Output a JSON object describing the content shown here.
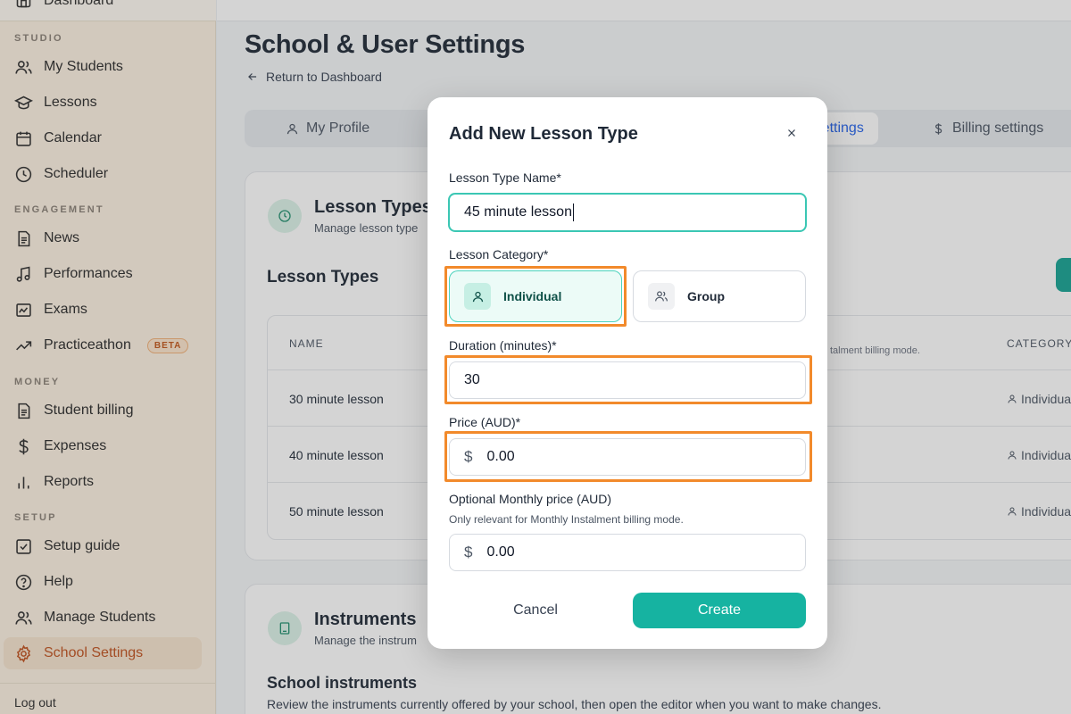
{
  "sidebar": {
    "top_item": "Dashboard",
    "sections": {
      "studio": "STUDIO",
      "engagement": "ENGAGEMENT",
      "money": "MONEY",
      "setup": "SETUP"
    },
    "items": {
      "my_students": "My Students",
      "lessons": "Lessons",
      "calendar": "Calendar",
      "scheduler": "Scheduler",
      "news": "News",
      "performances": "Performances",
      "exams": "Exams",
      "practiceathon": "Practiceathon",
      "practiceathon_badge": "BETA",
      "student_billing": "Student billing",
      "expenses": "Expenses",
      "reports": "Reports",
      "setup_guide": "Setup guide",
      "help": "Help",
      "manage_students": "Manage Students",
      "school_settings": "School Settings"
    },
    "logout": "Log out",
    "active_color": "#c0531f"
  },
  "page": {
    "title": "School & User Settings",
    "back_link": "Return to Dashboard",
    "tabs": {
      "my_profile": "My Profile",
      "settings": "Settings",
      "billing": "Billing settings"
    }
  },
  "lesson_types_card": {
    "title": "Lesson Types",
    "subtitle": "Manage lesson type",
    "section_heading": "Lesson Types",
    "columns": {
      "name": "NAME",
      "category": "CATEGORY"
    },
    "hint_fragment": "talment billing mode.",
    "rows": [
      {
        "name": "30 minute lesson",
        "category": "Individual"
      },
      {
        "name": "40 minute lesson",
        "category": "Individual"
      },
      {
        "name": "50 minute lesson",
        "category": "Individual"
      }
    ]
  },
  "instruments_card": {
    "title": "Instruments",
    "subtitle": "Manage the instrum",
    "section_heading": "School instruments",
    "description": "Review the instruments currently offered by your school, then open the editor when you want to make changes."
  },
  "modal": {
    "title": "Add New Lesson Type",
    "name_label": "Lesson Type Name*",
    "name_value": "45 minute lesson",
    "category_label": "Lesson Category*",
    "category_options": {
      "individual": "Individual",
      "group": "Group"
    },
    "category_selected": "individual",
    "duration_label": "Duration (minutes)*",
    "duration_value": "30",
    "price_label": "Price (AUD)*",
    "price_symbol": "$",
    "price_value": "0.00",
    "monthly_label": "Optional Monthly price (AUD)",
    "monthly_hint": "Only relevant for Monthly Instalment billing mode.",
    "monthly_symbol": "$",
    "monthly_value": "0.00",
    "cancel_label": "Cancel",
    "create_label": "Create",
    "accent_color": "#16b3a1",
    "highlight_color": "#f28a2b"
  }
}
